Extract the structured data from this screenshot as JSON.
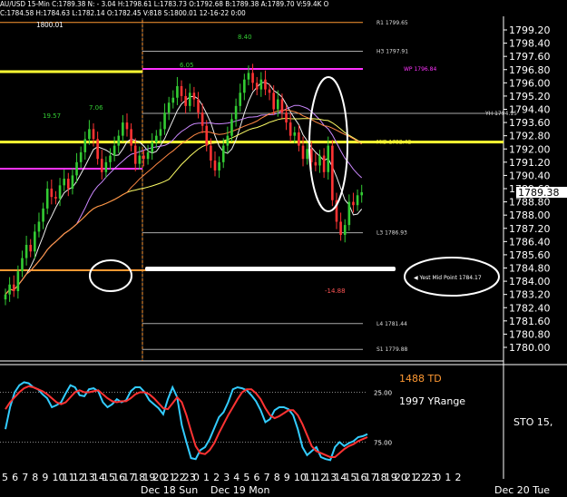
{
  "header": {
    "line1": "AU/USD 15-Min C:1789.38 N: - 3.04 H:1798.61 L:1783.73 O:1792.68 B:1789.38 A:1789.70 V:59.4K O",
    "line2": "C:1784.58 H:1784.63 L:1782.14 O:1782.45 V:818 S:1800.01 12-16-22 0:00",
    "mark": "1800.01"
  },
  "colors": {
    "background": "#000000",
    "up_candle": "#33cc33",
    "down_candle": "#ff3333",
    "pivot_upper": "#cc66ff",
    "pivot_lower": "#ffffff",
    "yellow": "#ffff33",
    "orange": "#ff9933",
    "magenta": "#ff33ff",
    "stoch_k": "#33ccff",
    "stoch_d": "#ff3333"
  },
  "chart_data": [
    {
      "type": "candlestick",
      "title": "AU/USD 15-Min",
      "current_price": "1789.38",
      "ylim": [
        1779.0,
        1800.2
      ],
      "y_ticks": [
        "1799.20",
        "1798.40",
        "1797.60",
        "1796.80",
        "1796.00",
        "1795.20",
        "1794.40",
        "1793.60",
        "1792.80",
        "1792.00",
        "1791.20",
        "1790.40",
        "1789.60",
        "1788.80",
        "1788.00",
        "1787.20",
        "1786.40",
        "1785.60",
        "1784.80",
        "1784.00",
        "1783.20",
        "1782.40",
        "1781.60",
        "1780.80",
        "1780.00"
      ],
      "levels": [
        {
          "label": "R1 1799.65",
          "value": 1799.65
        },
        {
          "label": "H3 1797.91",
          "value": 1797.91
        },
        {
          "label": "WP 1796.84",
          "value": 1796.84
        },
        {
          "label": "YH 1794.15",
          "value": 1794.15
        },
        {
          "label": "MID 1792.42",
          "value": 1792.42
        },
        {
          "label": "L3 1786.93",
          "value": 1786.93
        },
        {
          "label": "L4 1781.44",
          "value": 1781.44
        },
        {
          "label": "S1 1779.88",
          "value": 1779.88
        }
      ],
      "yest_mid_point": {
        "label": "Yest Mid Point 1784.17",
        "value": 1784.17
      },
      "annotations": [
        "19.57",
        "7.06",
        "6.05",
        "8.40",
        "-14.88"
      ],
      "x_labels": [
        "5",
        "6",
        "7",
        "8",
        "9",
        "10",
        "11",
        "12",
        "13",
        "14",
        "15",
        "16",
        "17",
        "18",
        "19",
        "20",
        "21",
        "22",
        "23",
        "0",
        "1",
        "2",
        "3",
        "4",
        "5",
        "6",
        "7",
        "8",
        "9",
        "10",
        "11",
        "12",
        "13",
        "14",
        "15",
        "16",
        "17",
        "18",
        "19",
        "20",
        "21",
        "22",
        "23",
        "0",
        "1",
        "2"
      ],
      "day_labels": [
        "Dec 18 Sun",
        "Dec 19 Mon",
        "Dec 20 Tue"
      ],
      "series": [
        {
          "name": "close",
          "values": [
            1783.2,
            1783.8,
            1783.4,
            1784.6,
            1785.4,
            1786.2,
            1785.8,
            1787.0,
            1787.6,
            1788.4,
            1789.6,
            1789.1,
            1789.0,
            1789.8,
            1790.2,
            1789.6,
            1790.4,
            1791.2,
            1791.8,
            1792.6,
            1793.2,
            1792.6,
            1791.4,
            1790.6,
            1791.2,
            1791.6,
            1792.2,
            1792.8,
            1793.6,
            1793.2,
            1792.2,
            1791.1,
            1791.6,
            1791.4,
            1791.8,
            1792.4,
            1792.8,
            1793.2,
            1794.2,
            1794.8,
            1795.1,
            1795.8,
            1795.2,
            1794.6,
            1795.4,
            1795.0,
            1794.2,
            1793.4,
            1792.2,
            1791.3,
            1790.7,
            1791.2,
            1792.2,
            1792.8,
            1793.8,
            1794.6,
            1795.4,
            1796.2,
            1796.6,
            1796.0,
            1795.6,
            1796.2,
            1795.6,
            1795.4,
            1794.4,
            1795.0,
            1794.2,
            1793.6,
            1792.8,
            1793.0,
            1792.2,
            1791.4,
            1792.0,
            1791.2,
            1791.0,
            1791.6,
            1790.6,
            1792.2,
            1788.9,
            1787.6,
            1786.8,
            1787.4,
            1788.8,
            1788.6,
            1789.2,
            1789.38
          ]
        }
      ]
    },
    {
      "type": "line",
      "title": "STO",
      "label_sto": "STO 15,",
      "label_td": "1488 TD",
      "label_yrange": "1997 YRange",
      "y_ticks": [
        "25.00",
        "75.00"
      ],
      "series": [
        {
          "name": "%K",
          "values": [
            62,
            40,
            25,
            18,
            15,
            16,
            20,
            22,
            27,
            31,
            40,
            38,
            35,
            26,
            18,
            20,
            28,
            29,
            22,
            21,
            24,
            35,
            40,
            37,
            32,
            35,
            33,
            24,
            20,
            20,
            25,
            33,
            37,
            41,
            47,
            32,
            20,
            30,
            58,
            75,
            91,
            92,
            83,
            80,
            72,
            61,
            50,
            45,
            35,
            22,
            20,
            21,
            23,
            28,
            34,
            43,
            55,
            52,
            43,
            40,
            40,
            42,
            48,
            62,
            80,
            88,
            84,
            80,
            90,
            92,
            93,
            80,
            75,
            79,
            76,
            74,
            70,
            69,
            67
          ]
        },
        {
          "name": "%D",
          "values": [
            42,
            35,
            30,
            25,
            21,
            19,
            20,
            22,
            24,
            27,
            31,
            35,
            37,
            35,
            30,
            25,
            23,
            25,
            25,
            24,
            23,
            27,
            31,
            34,
            35,
            34,
            34,
            31,
            27,
            25,
            25,
            27,
            31,
            36,
            41,
            42,
            36,
            30,
            35,
            48,
            64,
            79,
            86,
            87,
            83,
            76,
            66,
            57,
            48,
            40,
            32,
            25,
            22,
            22,
            26,
            32,
            41,
            48,
            51,
            49,
            46,
            43,
            43,
            48,
            57,
            68,
            79,
            84,
            86,
            88,
            90,
            90,
            86,
            82,
            79,
            77,
            74,
            72,
            70
          ]
        }
      ]
    }
  ]
}
